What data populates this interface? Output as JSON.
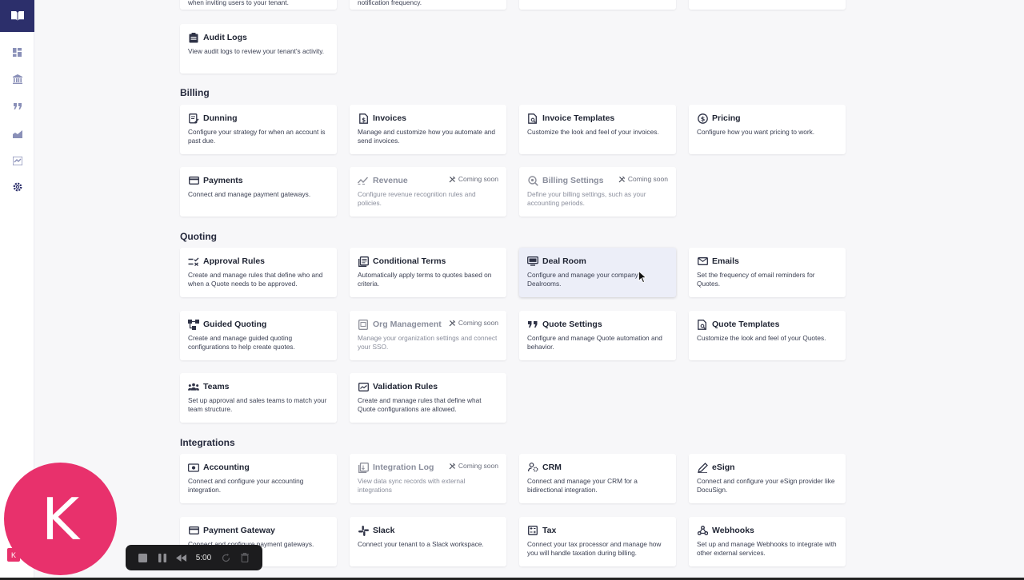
{
  "partial_top_descs": {
    "c1": "when inviting users to your tenant.",
    "c2": "notification frequency."
  },
  "sections": {
    "billing": "Billing",
    "quoting": "Quoting",
    "integrations": "Integrations"
  },
  "coming_soon_label": "Coming soon",
  "cards": {
    "audit_logs": {
      "title": "Audit Logs",
      "desc": "View audit logs to review your tenant's activity."
    },
    "dunning": {
      "title": "Dunning",
      "desc": "Configure your strategy for when an account is past due."
    },
    "invoices": {
      "title": "Invoices",
      "desc": "Manage and customize how you automate and send invoices."
    },
    "invoice_templates": {
      "title": "Invoice Templates",
      "desc": "Customize the look and feel of your invoices."
    },
    "pricing": {
      "title": "Pricing",
      "desc": "Configure how you want pricing to work."
    },
    "payments": {
      "title": "Payments",
      "desc": "Connect and manage payment gateways."
    },
    "revenue": {
      "title": "Revenue",
      "desc": "Configure revenue recognition rules and policies."
    },
    "billing_settings": {
      "title": "Billing Settings",
      "desc": "Define your billing settings, such as your accounting periods."
    },
    "approval_rules": {
      "title": "Approval Rules",
      "desc": "Create and manage rules that define who and when a Quote needs to be approved."
    },
    "conditional_terms": {
      "title": "Conditional Terms",
      "desc": "Automatically apply terms to quotes based on criteria."
    },
    "deal_room": {
      "title": "Deal Room",
      "desc": "Configure and manage your company's Dealrooms."
    },
    "emails": {
      "title": "Emails",
      "desc": "Set the frequency of email reminders for Quotes."
    },
    "guided_quoting": {
      "title": "Guided Quoting",
      "desc": "Create and manage guided quoting configurations to help create quotes."
    },
    "org_management": {
      "title": "Org Management",
      "desc": "Manage your organization settings and connect your SSO."
    },
    "quote_settings": {
      "title": "Quote Settings",
      "desc": "Configure and manage Quote automation and behavior."
    },
    "quote_templates": {
      "title": "Quote Templates",
      "desc": "Customize the look and feel of your Quotes."
    },
    "teams": {
      "title": "Teams",
      "desc": "Set up approval and sales teams to match your team structure."
    },
    "validation_rules": {
      "title": "Validation Rules",
      "desc": "Create and manage rules that define what Quote configurations are allowed."
    },
    "accounting": {
      "title": "Accounting",
      "desc": "Connect and configure your accounting integration."
    },
    "integration_log": {
      "title": "Integration Log",
      "desc": "View data sync records with external integrations"
    },
    "crm": {
      "title": "CRM",
      "desc": "Connect and manage your CRM for a bidirectional integration."
    },
    "esign": {
      "title": "eSign",
      "desc": "Connect and configure your eSign provider like DocuSign."
    },
    "payment_gateway": {
      "title": "Payment Gateway",
      "desc": "Connect and configure payment gateways."
    },
    "slack": {
      "title": "Slack",
      "desc": "Connect your tenant to a Slack workspace."
    },
    "tax": {
      "title": "Tax",
      "desc": "Connect your tax processor and manage how you will handle taxation during billing."
    },
    "webhooks": {
      "title": "Webhooks",
      "desc": "Set up and manage Webhooks to integrate with other external services."
    }
  },
  "avatar": {
    "initial": "K",
    "badge": "K"
  },
  "recorder": {
    "time": "5:00"
  },
  "colors": {
    "brand": "#2c2f6b",
    "avatar": "#e8316c",
    "hover_card": "#eceef8"
  }
}
